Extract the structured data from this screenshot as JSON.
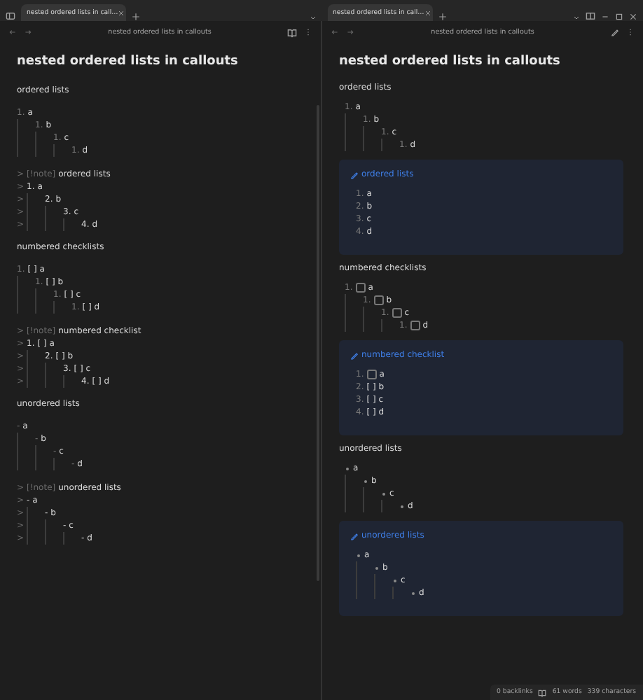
{
  "tabs": [
    {
      "title": "nested ordered lists in call…",
      "selected": true
    },
    {
      "title": "nested ordered lists in call…",
      "selected": true
    }
  ],
  "left": {
    "nav_title": "nested ordered lists in callouts",
    "title": "nested ordered lists in callouts",
    "blocks": [
      {
        "kind": "heading",
        "text": "ordered lists"
      },
      {
        "kind": "list",
        "items": [
          {
            "marker": "1.",
            "text": "a",
            "children": [
              {
                "marker": "1.",
                "text": "b",
                "children": [
                  {
                    "marker": "1.",
                    "text": "c",
                    "children": [
                      {
                        "marker": "1.",
                        "text": "d"
                      }
                    ]
                  }
                ]
              }
            ]
          }
        ]
      },
      {
        "kind": "callout",
        "quote": ">",
        "tag": "[!note]",
        "title": "ordered lists",
        "items": [
          {
            "quote": ">",
            "marker": "1.",
            "text": "a",
            "children": [
              {
                "quote": ">",
                "marker": "2.",
                "text": "b",
                "children": [
                  {
                    "quote": ">",
                    "marker": "3.",
                    "text": "c",
                    "children": [
                      {
                        "quote": ">",
                        "marker": "4.",
                        "text": "d"
                      }
                    ]
                  }
                ]
              }
            ]
          }
        ]
      },
      {
        "kind": "heading",
        "text": "numbered checklists"
      },
      {
        "kind": "list",
        "items": [
          {
            "marker": "1.",
            "text": "[ ] a",
            "children": [
              {
                "marker": "1.",
                "text": "[ ] b",
                "children": [
                  {
                    "marker": "1.",
                    "text": "[ ] c",
                    "children": [
                      {
                        "marker": "1.",
                        "text": "[ ] d"
                      }
                    ]
                  }
                ]
              }
            ]
          }
        ]
      },
      {
        "kind": "callout",
        "quote": ">",
        "tag": "[!note]",
        "title": "numbered checklist",
        "items": [
          {
            "quote": ">",
            "marker": "1.",
            "text": "[ ] a",
            "children": [
              {
                "quote": ">",
                "marker": "2.",
                "text": "[ ] b",
                "children": [
                  {
                    "quote": ">",
                    "marker": "3.",
                    "text": "[ ] c",
                    "children": [
                      {
                        "quote": ">",
                        "marker": "4.",
                        "text": "[ ] d"
                      }
                    ]
                  }
                ]
              }
            ]
          }
        ]
      },
      {
        "kind": "heading",
        "text": "unordered lists"
      },
      {
        "kind": "list",
        "items": [
          {
            "marker": "-",
            "text": "a",
            "children": [
              {
                "marker": "-",
                "text": "b",
                "children": [
                  {
                    "marker": "-",
                    "text": "c",
                    "children": [
                      {
                        "marker": "-",
                        "text": "d"
                      }
                    ]
                  }
                ]
              }
            ]
          }
        ]
      },
      {
        "kind": "callout",
        "quote": ">",
        "tag": "[!note]",
        "title": "unordered lists",
        "items": [
          {
            "quote": ">",
            "marker": "-",
            "text": "a",
            "children": [
              {
                "quote": ">",
                "marker": "-",
                "text": "b",
                "children": [
                  {
                    "quote": ">",
                    "marker": "-",
                    "text": "c",
                    "children": [
                      {
                        "quote": ">",
                        "marker": "-",
                        "text": "d"
                      }
                    ]
                  }
                ]
              }
            ]
          }
        ]
      }
    ]
  },
  "right": {
    "nav_title": "nested ordered lists in callouts",
    "title": "nested ordered lists in callouts",
    "blocks": [
      {
        "kind": "heading",
        "text": "ordered lists"
      },
      {
        "kind": "list",
        "items": [
          {
            "marker": "1.",
            "text": "a",
            "children": [
              {
                "marker": "1.",
                "text": "b",
                "children": [
                  {
                    "marker": "1.",
                    "text": "c",
                    "children": [
                      {
                        "marker": "1.",
                        "text": "d"
                      }
                    ]
                  }
                ]
              }
            ]
          }
        ]
      },
      {
        "kind": "callout",
        "title": "ordered lists",
        "items": [
          {
            "marker": "1.",
            "text": "a"
          },
          {
            "marker": "2.",
            "text": "b"
          },
          {
            "marker": "3.",
            "text": "c"
          },
          {
            "marker": "4.",
            "text": "d"
          }
        ]
      },
      {
        "kind": "heading",
        "text": "numbered checklists"
      },
      {
        "kind": "list",
        "items": [
          {
            "marker": "1.",
            "checked": false,
            "text": "a",
            "children": [
              {
                "marker": "1.",
                "checked": false,
                "text": "b",
                "children": [
                  {
                    "marker": "1.",
                    "checked": false,
                    "text": "c",
                    "children": [
                      {
                        "marker": "1.",
                        "checked": false,
                        "text": "d"
                      }
                    ]
                  }
                ]
              }
            ]
          }
        ]
      },
      {
        "kind": "callout",
        "title": "numbered checklist",
        "items": [
          {
            "marker": "1.",
            "checked": false,
            "text": "a"
          },
          {
            "marker": "2.",
            "text": "[ ] b"
          },
          {
            "marker": "3.",
            "text": "[ ] c"
          },
          {
            "marker": "4.",
            "text": "[ ] d"
          }
        ]
      },
      {
        "kind": "heading",
        "text": "unordered lists"
      },
      {
        "kind": "list",
        "items": [
          {
            "text": "a",
            "children": [
              {
                "text": "b",
                "children": [
                  {
                    "text": "c",
                    "children": [
                      {
                        "text": "d"
                      }
                    ]
                  }
                ]
              }
            ]
          }
        ]
      },
      {
        "kind": "callout",
        "title": "unordered lists",
        "items": [
          {
            "text": "a",
            "children": [
              {
                "text": "b",
                "children": [
                  {
                    "text": "c",
                    "children": [
                      {
                        "text": "d"
                      }
                    ]
                  }
                ]
              }
            ]
          }
        ]
      }
    ]
  },
  "status_bar": {
    "backlinks": "0 backlinks",
    "words": "61 words",
    "characters": "339 characters"
  }
}
